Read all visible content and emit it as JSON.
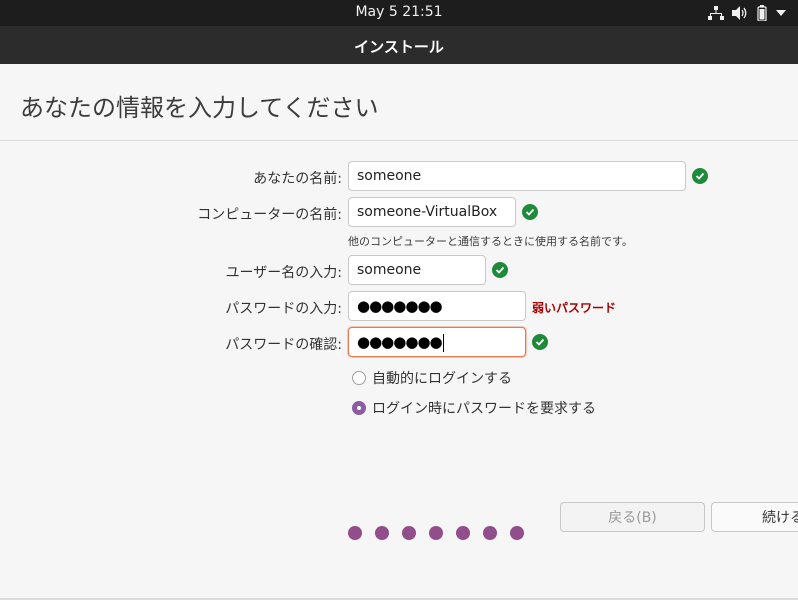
{
  "system_bar": {
    "clock": "May 5  21:51"
  },
  "window": {
    "title": "インストール"
  },
  "page": {
    "heading": "あなたの情報を入力してください"
  },
  "form": {
    "name": {
      "label": "あなたの名前:",
      "value": "someone"
    },
    "computer": {
      "label": "コンピューターの名前:",
      "value": "someone-VirtualBox",
      "hint": "他のコンピューターと通信するときに使用する名前です。"
    },
    "username": {
      "label": "ユーザー名の入力:",
      "value": "someone"
    },
    "password": {
      "label": "パスワードの入力:",
      "value": "●●●●●●●",
      "strength": "弱いパスワード"
    },
    "confirm": {
      "label": "パスワードの確認:",
      "value": "●●●●●●●"
    },
    "login_options": [
      {
        "label": "自動的にログインする",
        "selected": false
      },
      {
        "label": "ログイン時にパスワードを要求する",
        "selected": true
      }
    ]
  },
  "buttons": {
    "back": "戻る(B)",
    "next": "続ける"
  },
  "progress": {
    "steps": 7
  },
  "colors": {
    "accent": "#924d8b",
    "valid": "#1f8a3a",
    "warning": "#a80000",
    "focus": "#e67a50"
  }
}
